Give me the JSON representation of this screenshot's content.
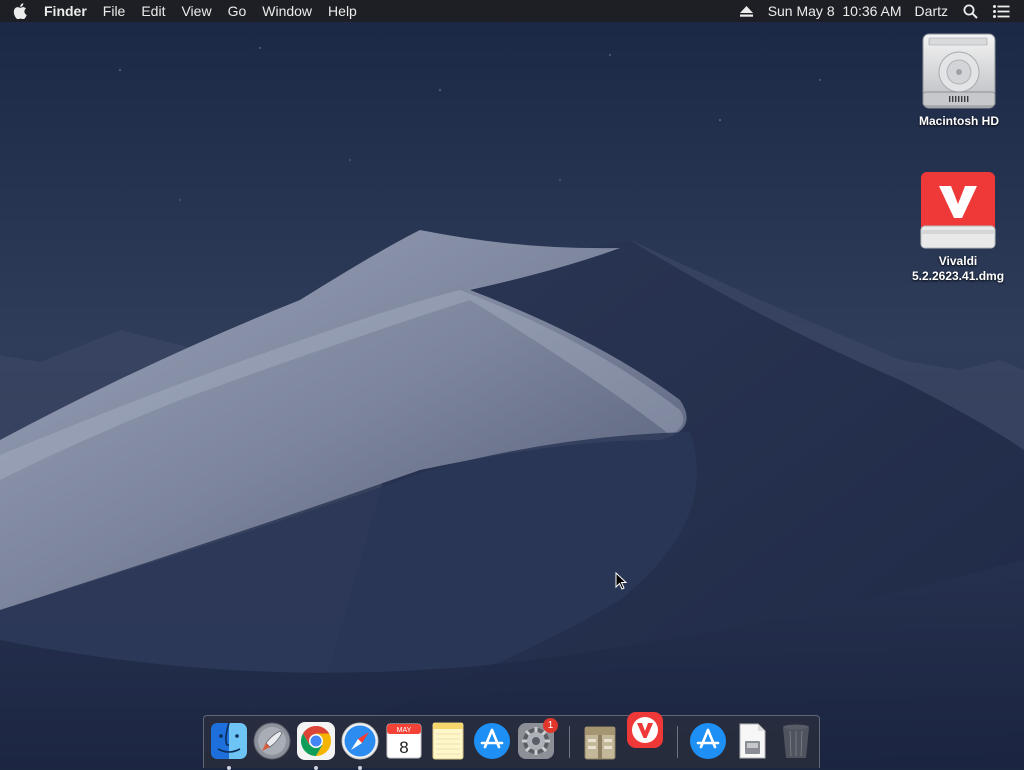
{
  "menubar": {
    "app_name": "Finder",
    "menus": [
      "File",
      "Edit",
      "View",
      "Go",
      "Window",
      "Help"
    ],
    "clock": "Sun May 8  10:36 AM",
    "user": "Dartz"
  },
  "desktop": {
    "icons": [
      {
        "label": "Macintosh HD"
      },
      {
        "label_line1": "Vivaldi",
        "label_line2": "5.2.2623.41.dmg"
      }
    ]
  },
  "dock": {
    "calendar_month": "MAY",
    "calendar_day": "8",
    "system_preferences_badge": "1",
    "items": [
      "finder-icon",
      "launchpad-icon",
      "chrome-icon",
      "safari-icon",
      "calendar-icon",
      "notes-icon",
      "app-store-icon",
      "system-preferences-icon",
      "archive-utility-icon",
      "vivaldi-icon",
      "app-store-icon",
      "document-icon",
      "trash-icon"
    ]
  },
  "colors": {
    "vivaldi_red": "#ef3939",
    "sky_dark": "#1a2744",
    "dune_light": "#8e97ad"
  }
}
